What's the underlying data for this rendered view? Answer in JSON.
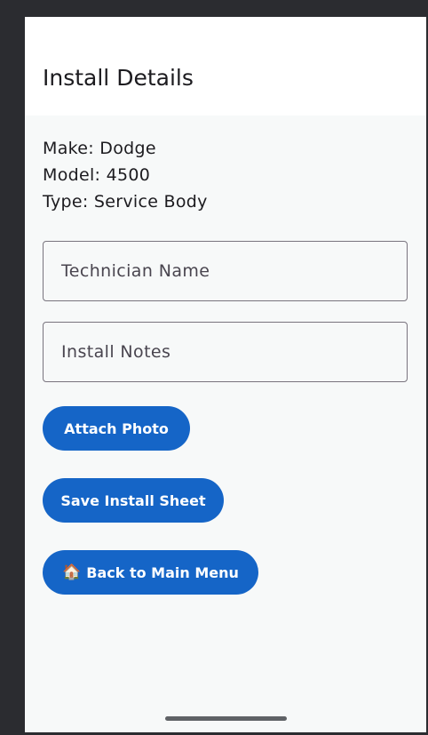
{
  "header": {
    "title": "Install Details"
  },
  "vehicle": {
    "make": "Make: Dodge",
    "model": "Model: 4500",
    "type": "Type: Service Body"
  },
  "form": {
    "technician_placeholder": "Technician Name",
    "notes_placeholder": "Install Notes"
  },
  "actions": {
    "attach_photo": "Attach Photo",
    "save_install_sheet": "Save Install Sheet",
    "back_icon": "🏠",
    "back_to_menu": "Back to Main Menu"
  },
  "colors": {
    "accent": "#1565c7",
    "background": "#f7f9f9",
    "frame": "#2b2c30"
  },
  "icons": {
    "back_icon_name": "home-icon"
  }
}
